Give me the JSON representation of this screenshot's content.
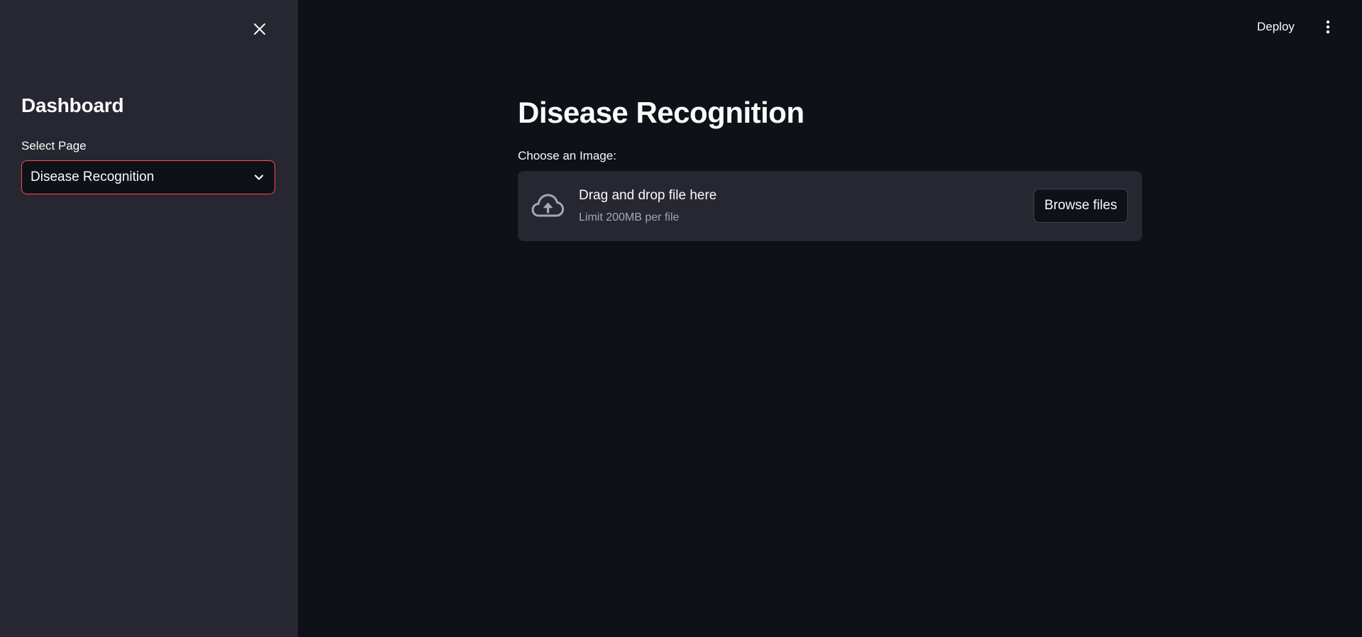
{
  "sidebar": {
    "close_icon": "close-icon",
    "title": "Dashboard",
    "select": {
      "label": "Select Page",
      "value": "Disease Recognition",
      "chevron_icon": "chevron-down-icon",
      "focus_border_color": "#ff4b4b"
    }
  },
  "header": {
    "deploy_label": "Deploy",
    "menu_icon": "vertical-dots-icon"
  },
  "main": {
    "title": "Disease Recognition",
    "uploader": {
      "label": "Choose an Image:",
      "icon": "cloud-upload-icon",
      "drop_text": "Drag and drop file here",
      "limit_text": "Limit 200MB per file",
      "browse_label": "Browse files"
    }
  },
  "colors": {
    "background": "#0e1117",
    "sidebar_background": "#262730",
    "text": "#fafafa",
    "muted_text": "#a3a8b8",
    "accent": "#ff4b4b"
  }
}
